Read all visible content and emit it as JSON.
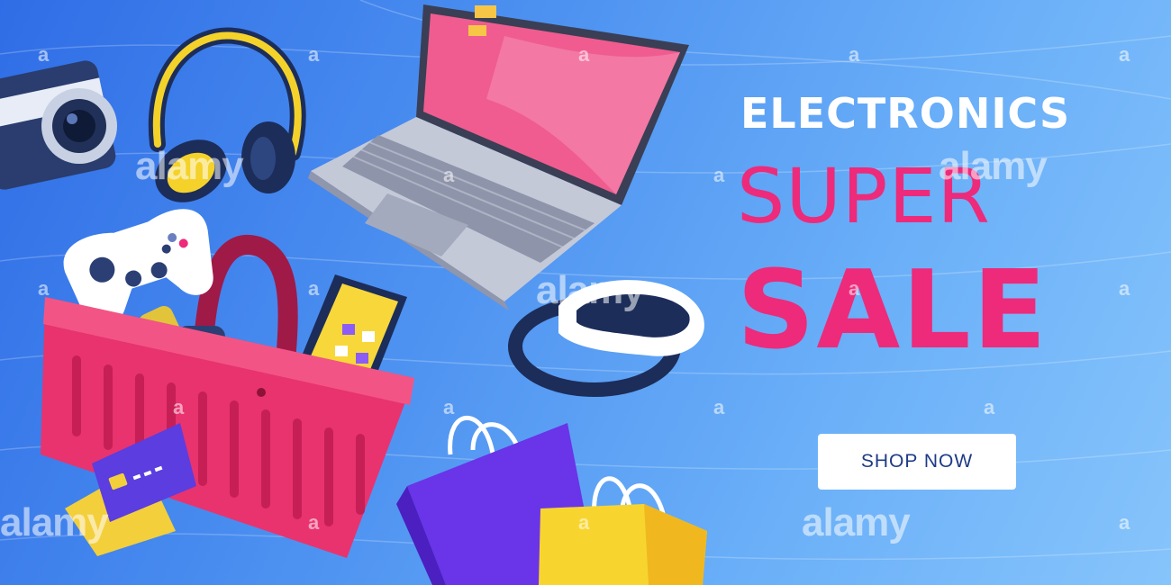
{
  "headline": {
    "line1": "ELECTRONICS",
    "line2": "SUPER",
    "line3": "SALE"
  },
  "cta": {
    "label": "SHOP NOW"
  },
  "watermark": {
    "word": "alamy",
    "letter": "a"
  },
  "colors": {
    "accent": "#ee2a7b",
    "background_start": "#2f6de6",
    "background_end": "#86c4fb",
    "cta_text": "#1d3b87"
  },
  "icons": [
    "camera-icon",
    "headphones-icon",
    "laptop-icon",
    "game-controller-icon",
    "smartwatch-icon",
    "smartphone-icon",
    "vr-headset-icon",
    "shopping-basket-icon",
    "credit-card-icon",
    "shopping-bag-icon"
  ]
}
